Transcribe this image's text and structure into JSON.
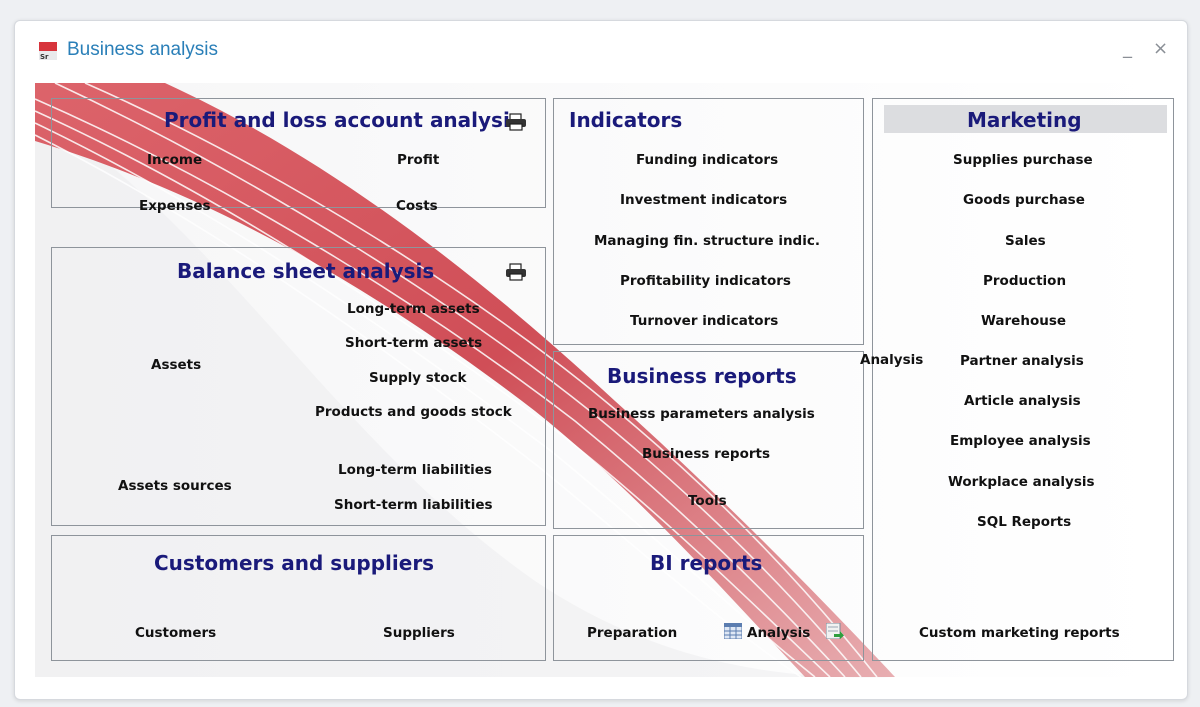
{
  "window": {
    "title": "Business analysis",
    "minimize_glyph": "_",
    "close_glyph": "×",
    "app_icon_text": "Sr"
  },
  "profit_loss": {
    "title": "Profit and loss account analysis",
    "items": {
      "income": "Income",
      "profit": "Profit",
      "expenses": "Expenses",
      "costs": "Costs"
    }
  },
  "balance": {
    "title": "Balance sheet analysis",
    "assets": "Assets",
    "assets_sources": "Assets sources",
    "items": {
      "long_term_assets": "Long-term assets",
      "short_term_assets": "Short-term assets",
      "supply_stock": "Supply stock",
      "products_goods_stock": "Products and goods stock",
      "long_term_liabilities": "Long-term liabilities",
      "short_term_liabilities": "Short-term liabilities"
    }
  },
  "customers": {
    "title": "Customers and suppliers",
    "customers": "Customers",
    "suppliers": "Suppliers"
  },
  "indicators": {
    "title": "Indicators",
    "items": [
      "Funding indicators",
      "Investment indicators",
      "Managing fin. structure indic.",
      "Profitability indicators",
      "Turnover indicators"
    ]
  },
  "business_reports": {
    "title": "Business reports",
    "items": [
      "Business parameters analysis",
      "Business reports",
      "Tools"
    ]
  },
  "bi_reports": {
    "title": "BI reports",
    "preparation": "Preparation",
    "analysis": "Analysis"
  },
  "marketing": {
    "title": "Marketing",
    "items": [
      "Supplies purchase",
      "Goods purchase",
      "Sales",
      "Production",
      "Warehouse"
    ],
    "analysis_label": "Analysis",
    "analysis_items": [
      "Partner analysis",
      "Article analysis",
      "Employee analysis",
      "Workplace analysis",
      "SQL Reports"
    ],
    "custom": "Custom marketing reports"
  },
  "icons": {
    "print": "printer-icon",
    "grid": "grid-table-icon",
    "export": "export-icon"
  },
  "colors": {
    "title_blue": "#2a7fb8",
    "header_navy": "#1a1a7a",
    "ribbon_red": "#c8303a"
  }
}
